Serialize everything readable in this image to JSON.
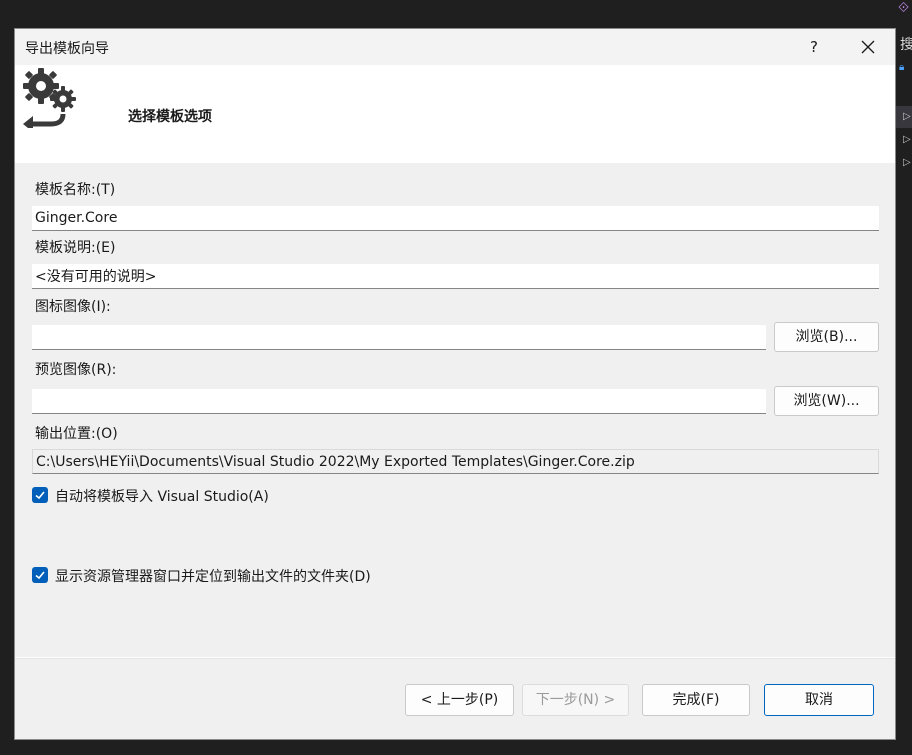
{
  "background_ide": {
    "logo_icon": "visual-studio-icon",
    "partial_text": "搜",
    "lock_icon": "lock-icon",
    "arrow_icon": "expand-arrow-icon"
  },
  "dialog": {
    "title": "导出模板向导",
    "help_label": "?",
    "close_label": "✕",
    "header_icon": "gears-export-icon",
    "header_title": "选择模板选项"
  },
  "form": {
    "template_name_label": "模板名称:(T)",
    "template_name_value": "Ginger.Core",
    "template_desc_label": "模板说明:(E)",
    "template_desc_value": "<没有可用的说明>",
    "icon_image_label": "图标图像(I):",
    "icon_image_value": "",
    "browse_b_label": "浏览(B)...",
    "preview_image_label": "预览图像(R):",
    "preview_image_value": "",
    "browse_w_label": "浏览(W)...",
    "output_location_label": "输出位置:(O)",
    "output_location_value": "C:\\Users\\HEYii\\Documents\\Visual Studio 2022\\My Exported Templates\\Ginger.Core.zip",
    "auto_import_label": "自动将模板导入 Visual Studio(A)",
    "auto_import_checked": true,
    "show_explorer_label": "显示资源管理器窗口并定位到输出文件的文件夹(D)",
    "show_explorer_checked": true
  },
  "footer": {
    "prev_label": "< 上一步(P)",
    "next_label": "下一步(N) >",
    "finish_label": "完成(F)",
    "cancel_label": "取消"
  },
  "colors": {
    "accent": "#005fb8",
    "dialog_bg": "#f0f0f0",
    "header_bg": "#ffffff",
    "ide_bg": "#1f1f1f"
  }
}
